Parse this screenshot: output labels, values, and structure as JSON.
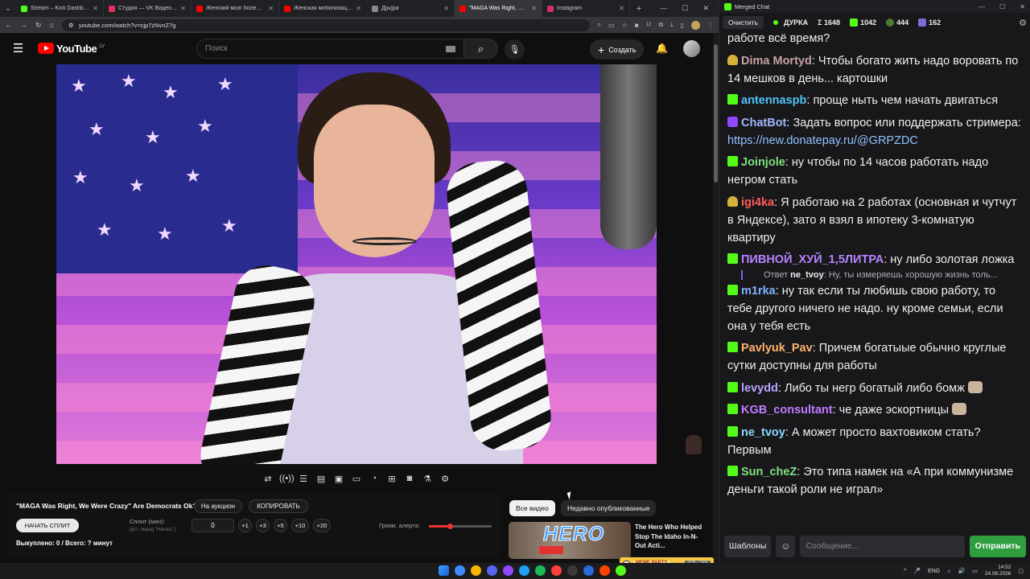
{
  "browser": {
    "tabs": [
      {
        "title": "Stream – Kick Dashboard",
        "favicon_color": "#53fc18",
        "active": false
      },
      {
        "title": "Студия — VK Видео Live",
        "favicon_color": "#e3305a",
        "active": false
      },
      {
        "title": "Женский мозг более раз...",
        "favicon_color": "#ff0000",
        "active": false
      },
      {
        "title": "Женская мобилизация со...",
        "favicon_color": "#ff0000",
        "active": false
      },
      {
        "title": "Д[ы]ра",
        "favicon_color": "#888888",
        "active": false
      },
      {
        "title": "\"MAGA Was Right, We Wer...",
        "favicon_color": "#ff0000",
        "active": true
      },
      {
        "title": "Instagram",
        "favicon_color": "#d62976",
        "active": false
      }
    ],
    "url": "youtube.com/watch?v=cjp7zNvnZ7g",
    "badge_count": "12"
  },
  "youtube": {
    "logo_text": "YouTube",
    "country_code": "LV",
    "search_placeholder": "Поиск",
    "create_label": "Создать"
  },
  "auction": {
    "video_title": "\"MAGA Was Right, We Were Crazy\" Are Democrats Ok?",
    "btn_auction": "На аукцион",
    "btn_copy": "КОПИРОВАТЬ",
    "btn_start": "НАЧАТЬ СПЛИТ",
    "split_label": "Сплит (мин):",
    "split_hint": "(уст. перед \"Начать\")",
    "split_value": "0",
    "increments": [
      "+1",
      "+3",
      "+5",
      "+10",
      "+20"
    ],
    "volume_label": "Громк. алерта:",
    "volume_fraction": 0.33,
    "sold_text": "Выкуплено: 0 / Всего: ? минут"
  },
  "recommendations": {
    "chip_all": "Все видео",
    "chip_recent": "Недавно опубликованные",
    "thumb_text": "HERO",
    "video_title": "The Hero Who Helped Stop The Idaho In-N-Out Acti..."
  },
  "meme_party": {
    "label": "MEME PARTY",
    "progress": "1025 / 1500"
  },
  "chat": {
    "window_title": "Merged Chat",
    "clear_label": "Очистить",
    "channel": "ДУРКА",
    "total_label": "Σ 1648",
    "kick_count": "1042",
    "vk_count": "444",
    "twitch_count": "162",
    "messages": [
      {
        "icon": "none",
        "user": "",
        "color": "#efeff1",
        "text": "работе всё время?"
      },
      {
        "icon": "helmet",
        "user": "Dima Mortyd",
        "color": "#c8a2a2",
        "text": "Чтобы богато жить надо воровать по 14 мешков в день... картошки"
      },
      {
        "icon": "kick",
        "user": "antennaspb",
        "color": "#4fc3f7",
        "text": "проще ныть чем начать двигаться"
      },
      {
        "icon": "bot",
        "user": "ChatBot",
        "color": "#9fb7ff",
        "text": "Задать вопрос или поддержать стримера:",
        "link": "https://new.donatepay.ru/@GRPZDC"
      },
      {
        "icon": "kick",
        "user": "Joinjole",
        "color": "#7ee07e",
        "text": "ну чтобы по 14 часов работать надо негром стать"
      },
      {
        "icon": "helmet",
        "user": "igi4ka",
        "color": "#ff5b5b",
        "text": "Я работаю на 2 работах (основная и чутчут в Яндексе), зато я взял в ипотеку 3-комнатую квартиру"
      },
      {
        "icon": "kick",
        "user": "ПИВНОЙ_ХУЙ_1,5ЛИТРА",
        "color": "#b784ff",
        "text": "ну либо золотая ложка"
      },
      {
        "icon": "kick",
        "user": "m1rka",
        "color": "#7fb2ff",
        "text": "ну так если ты любишь свою работу, то тебе другого ничего не надо. ну кроме семьи, если она у тебя есть",
        "reply_label": "Ответ",
        "reply_user": "ne_tvoy",
        "reply_text": "Ну, ты измеряешь хорошую жизнь толь..."
      },
      {
        "icon": "kick",
        "user": "Pavlyuk_Pav",
        "color": "#ffb36b",
        "text": "Причем богатыые обычно круглые сутки доступны для работы"
      },
      {
        "icon": "kick",
        "user": "levydd",
        "color": "#b9a2ff",
        "text": "Либо ты негр богатый либо бомж",
        "emote": true
      },
      {
        "icon": "kick",
        "user": "KGB_consultant",
        "color": "#c07cff",
        "text": "че даже эскортницы",
        "emote": true
      },
      {
        "icon": "kick",
        "user": "ne_tvoy",
        "color": "#8ad8ff",
        "text": "А может просто вахтовиком стать? Первым"
      },
      {
        "icon": "kick",
        "user": "Sun_cheZ",
        "color": "#7fe07f",
        "text": "Это типа намек на «А при коммунизме деньги такой роли не играл»"
      }
    ],
    "templates_label": "Шаблоны",
    "input_placeholder": "Сообщение...",
    "send_label": "Отправить"
  },
  "taskbar": {
    "lang": "ENG",
    "time": "14:52",
    "date": "24.08.2026",
    "app_colors": [
      "#3c8cff",
      "#f7b500",
      "#5865f2",
      "#9146ff",
      "#1da1f2",
      "#1db954",
      "#ff3d3d",
      "#3a3a3a",
      "#2a6ad8",
      "#ff4500",
      "#53fc18"
    ]
  }
}
